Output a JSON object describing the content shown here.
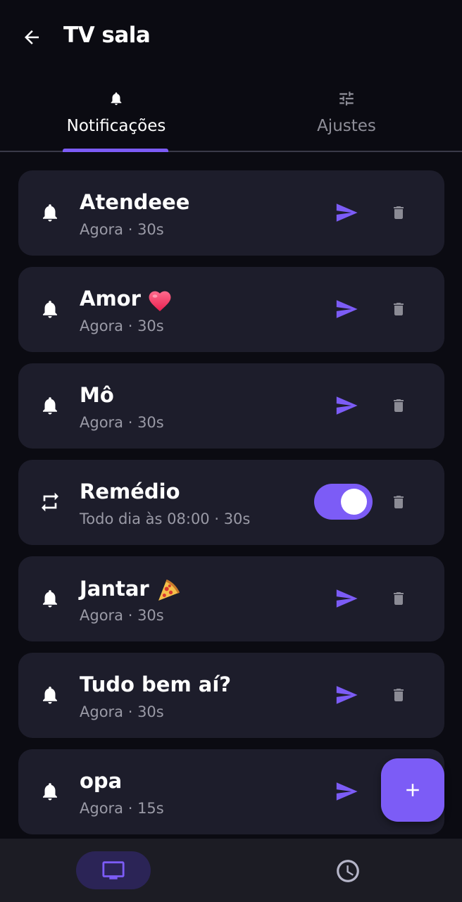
{
  "header": {
    "title": "TV sala",
    "back_icon": "arrow-left-icon"
  },
  "tabs": [
    {
      "label": "Notificações",
      "icon": "bell-icon",
      "active": true
    },
    {
      "label": "Ajustes",
      "icon": "sliders-icon",
      "active": false
    }
  ],
  "notifications": [
    {
      "title": "Atendeee",
      "subtitle": "Agora · 30s",
      "type": "once",
      "icon": "bell-icon",
      "action": "send-icon"
    },
    {
      "title": "Amor",
      "emoji": "heart-emoji",
      "subtitle": "Agora · 30s",
      "type": "once",
      "icon": "bell-icon",
      "action": "send-icon"
    },
    {
      "title": "Mô",
      "subtitle": "Agora · 30s",
      "type": "once",
      "icon": "bell-icon",
      "action": "send-icon"
    },
    {
      "title": "Remédio",
      "subtitle": "Todo dia às 08:00 · 30s",
      "type": "repeat",
      "icon": "repeat-icon",
      "action": "toggle",
      "enabled": true
    },
    {
      "title": "Jantar",
      "emoji": "pizza-emoji",
      "subtitle": "Agora · 30s",
      "type": "once",
      "icon": "bell-icon",
      "action": "send-icon"
    },
    {
      "title": "Tudo bem aí?",
      "subtitle": "Agora · 30s",
      "type": "once",
      "icon": "bell-icon",
      "action": "send-icon"
    },
    {
      "title": "opa",
      "subtitle": "Agora · 15s",
      "type": "once",
      "icon": "bell-icon",
      "action": "send-icon"
    }
  ],
  "fab": {
    "icon": "plus-icon"
  },
  "bottom_nav": [
    {
      "icon": "tv-icon",
      "active": true
    },
    {
      "icon": "clock-icon",
      "active": false
    }
  ],
  "colors": {
    "background": "#0b0b12",
    "card": "#1d1d2b",
    "accent": "#7c5cf6",
    "muted_text": "#9a9aa6",
    "trash": "#8b8b95",
    "nav_bar": "#1c1c24",
    "nav_active_pill": "#2b2456"
  }
}
